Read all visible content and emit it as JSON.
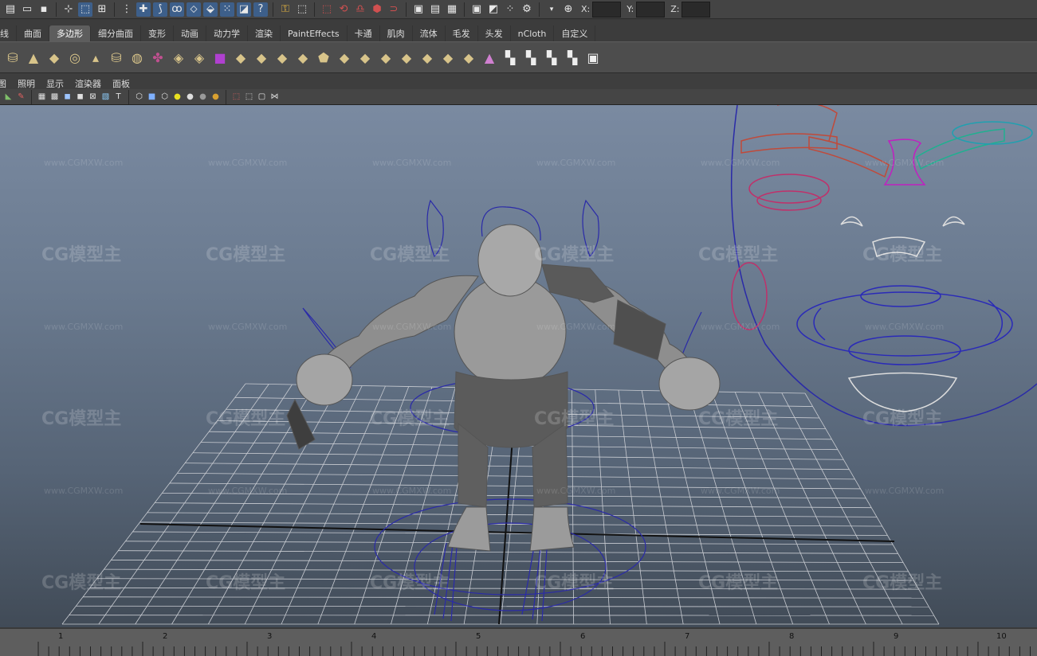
{
  "status_line": {
    "icons": [
      "new-scene-icon",
      "open-scene-icon",
      "save-scene-icon",
      "select-hierarchy-icon",
      "select-object-icon",
      "select-component-icon",
      "lock-selection-icon",
      "snap-grid-icon",
      "snap-curve-icon",
      "snap-point-icon",
      "snap-plane-icon",
      "snap-live-icon",
      "snap-view-icon",
      "help-icon",
      "input-ops-icon",
      "construction-history-icon",
      "render-frame-icon",
      "render-ipr-icon",
      "render-settings-icon",
      "hypershade-icon",
      "magnet-icon",
      "toggle-panel-icon",
      "toggle-attr-icon",
      "channel-box-icon",
      "render-view-icon",
      "clapper-icon",
      "dotted-icon",
      "numeric-input-icon"
    ],
    "coords": {
      "x_label": "X:",
      "y_label": "Y:",
      "z_label": "Z:"
    }
  },
  "shelf_tabs": [
    "线",
    "曲面",
    "多边形",
    "细分曲面",
    "变形",
    "动画",
    "动力学",
    "渲染",
    "PaintEffects",
    "卡通",
    "肌肉",
    "流体",
    "毛发",
    "头发",
    "nCloth",
    "自定义"
  ],
  "active_shelf_tab": "多边形",
  "shelf_icons": [
    "poly-cube-icon",
    "poly-cone-icon",
    "poly-plane-icon",
    "poly-torus-icon",
    "poly-pyramid-icon",
    "poly-cylinder-icon",
    "sculpt-sphere-icon",
    "combine-icon",
    "separate-icon",
    "smooth-icon",
    "boolean-icon",
    "purple-cube-icon",
    "extrude-face-icon",
    "extrude-edge-icon",
    "bridge-icon",
    "append-icon",
    "split-icon",
    "bevel-icon",
    "cut-faces-icon",
    "merge-icon",
    "collapse-icon",
    "insert-loop-icon",
    "offset-loop-icon",
    "triangulate-icon",
    "quadrangulate-icon",
    "cone-tool-icon",
    "uv-checker-icon",
    "uv-layout-icon",
    "uv-unfold-icon",
    "uv-planar-icon",
    "uv-editor-icon"
  ],
  "panel_menu": [
    "视图",
    "照明",
    "显示",
    "渲染器",
    "面板"
  ],
  "panel_toolbar_icons": [
    "camera-attr-icon",
    "bookmark-icon",
    "grid-toggle-icon",
    "wireframe-icon",
    "smooth-shade-icon",
    "flat-shade-icon",
    "bounding-box-icon",
    "texture-icon",
    "lights-icon",
    "shadows-icon",
    "xray-icon",
    "isolate-icon",
    "cube-a-icon",
    "cube-b-icon",
    "cube-c-icon",
    "sphere-yellow-icon",
    "sphere-white-icon",
    "sphere-gray-icon",
    "sphere-gold-icon",
    "select-camera-icon",
    "film-gate-icon",
    "resolution-gate-icon",
    "field-chart-icon"
  ],
  "watermark": {
    "logo": "CG模型主",
    "url": "www.CGMXW.com"
  },
  "timeline": {
    "ticks": [
      "1",
      "2",
      "3",
      "4",
      "5",
      "6",
      "7",
      "8",
      "9",
      "10"
    ]
  }
}
